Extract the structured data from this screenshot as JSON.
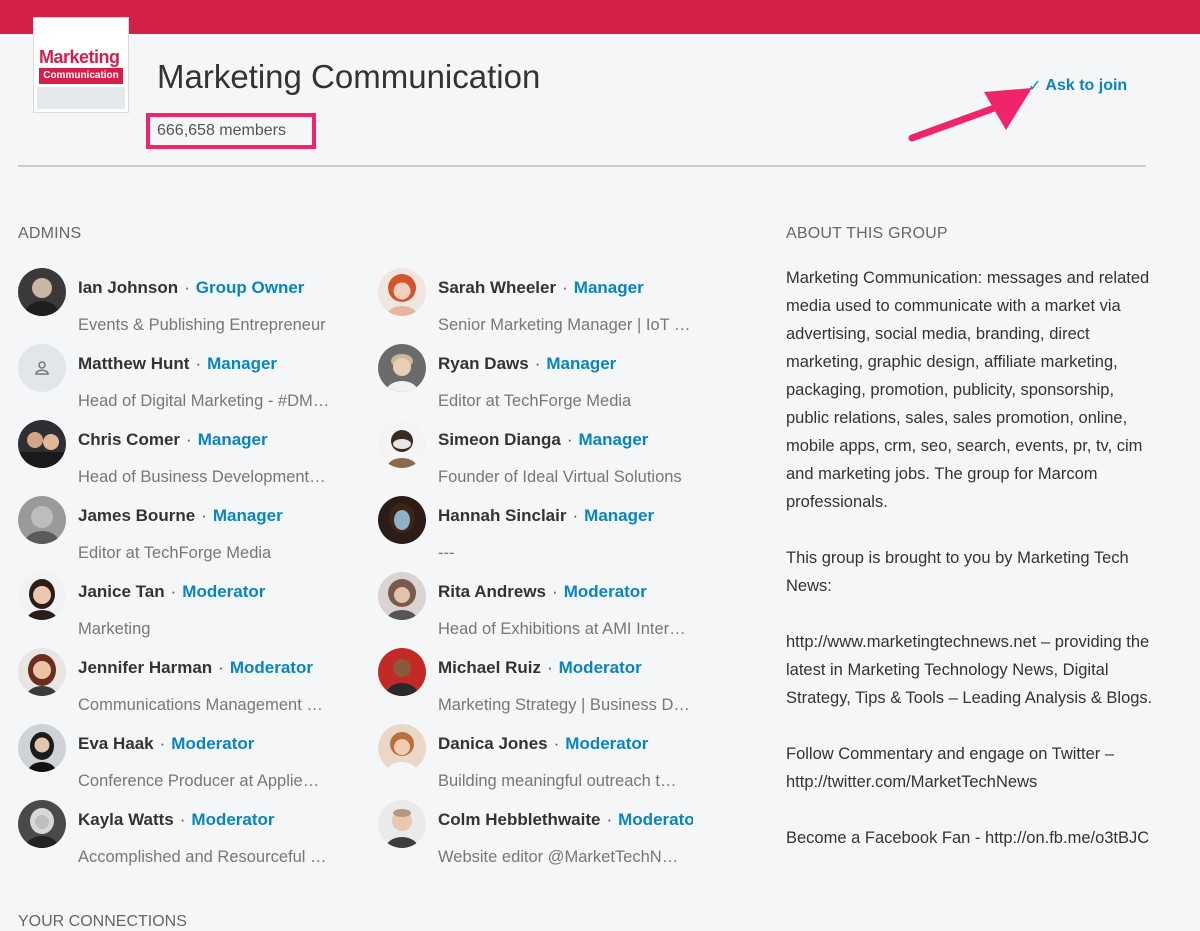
{
  "group": {
    "title": "Marketing Communication",
    "members": "666,658 members",
    "join_label": "Ask to join",
    "logo_word1": "Marketing",
    "logo_word2": "Communication"
  },
  "admins_label": "ADMINS",
  "about_label": "ABOUT THIS GROUP",
  "connections_label": "YOUR CONNECTIONS",
  "admins_left": [
    {
      "name": "Ian Johnson",
      "role": "Group Owner",
      "subtitle": "Events & Publishing Entrepreneur"
    },
    {
      "name": "Matthew Hunt",
      "role": "Manager",
      "subtitle": "Head of Digital Marketing - #DM…"
    },
    {
      "name": "Chris Comer",
      "role": "Manager",
      "subtitle": "Head of Business Development…"
    },
    {
      "name": "James Bourne",
      "role": "Manager",
      "subtitle": "Editor at TechForge Media"
    },
    {
      "name": "Janice Tan",
      "role": "Moderator",
      "subtitle": "Marketing"
    },
    {
      "name": "Jennifer Harman",
      "role": "Moderator",
      "subtitle": "Communications Management …"
    },
    {
      "name": "Eva Haak",
      "role": "Moderator",
      "subtitle": "Conference Producer at Applie…"
    },
    {
      "name": "Kayla Watts",
      "role": "Moderator",
      "subtitle": "Accomplished and Resourceful …"
    }
  ],
  "admins_right": [
    {
      "name": "Sarah Wheeler",
      "role": "Manager",
      "subtitle": "Senior Marketing Manager | IoT …"
    },
    {
      "name": "Ryan Daws",
      "role": "Manager",
      "subtitle": "Editor at TechForge Media"
    },
    {
      "name": "Simeon Dianga",
      "role": "Manager",
      "subtitle": "Founder of Ideal Virtual Solutions"
    },
    {
      "name": "Hannah Sinclair",
      "role": "Manager",
      "subtitle": "---"
    },
    {
      "name": "Rita Andrews",
      "role": "Moderator",
      "subtitle": "Head of Exhibitions at AMI Inter…"
    },
    {
      "name": "Michael Ruiz",
      "role": "Moderator",
      "subtitle": "Marketing Strategy | Business D…"
    },
    {
      "name": "Danica Jones",
      "role": "Moderator",
      "subtitle": "Building meaningful outreach t…"
    },
    {
      "name": "Colm Hebblethwaite",
      "role": "Moderator",
      "subtitle": "Website editor @MarketTechN…"
    }
  ],
  "about": [
    "Marketing Communication: messages and related media used to communicate with a market via advertising, social media, branding, direct marketing, graphic design, affiliate marketing, packaging, promotion, publicity, sponsorship, public relations, sales, sales promotion, online, mobile apps, crm, seo, search, events, pr, tv, cim and marketing jobs. The group for Marcom professionals.",
    "This group is brought to you by Marketing Tech News:",
    "http://www.marketingtechnews.net – providing the latest in Marketing Technology News, Digital Strategy, Tips & Tools – Leading Analysis & Blogs.",
    "Follow Commentary and engage on Twitter – http://twitter.com/MarketTechNews",
    "Become a Facebook Fan - http://on.fb.me/o3tBJC"
  ],
  "colors": {
    "brand": "#d41f49",
    "link": "#0a84c1",
    "highlight": "#f0246b"
  }
}
